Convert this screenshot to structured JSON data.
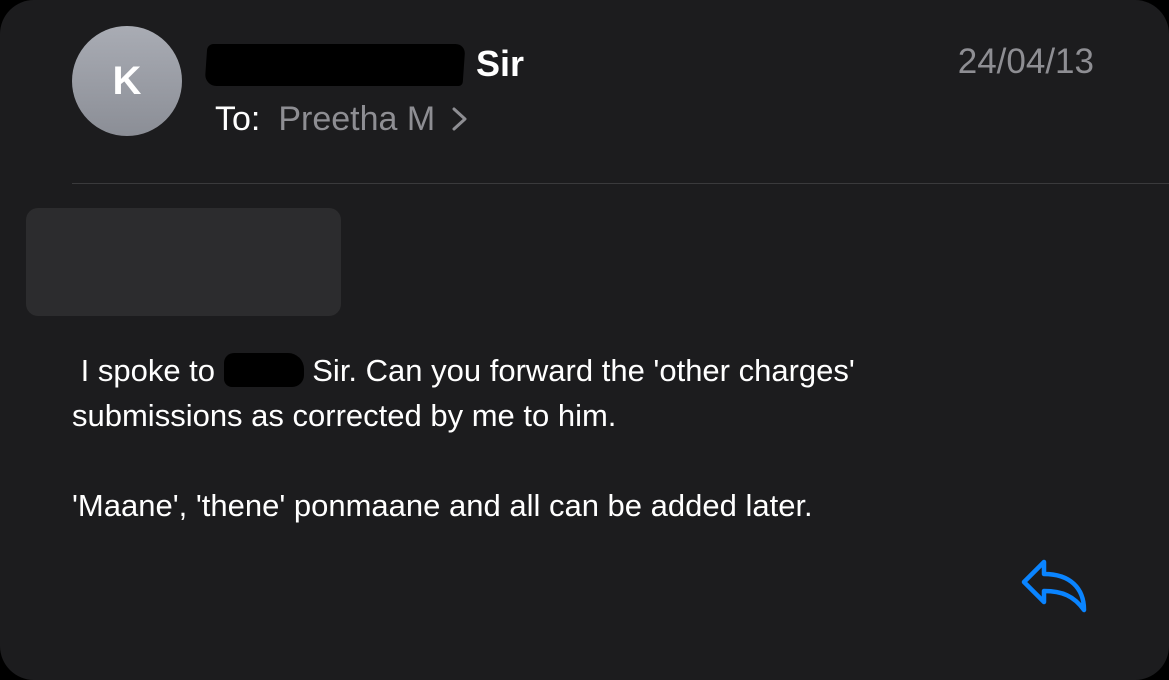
{
  "message": {
    "avatar_initial": "K",
    "sender_suffix": "Sir",
    "date": "24/04/13",
    "to_label": "To:",
    "recipient": "Preetha M",
    "body": {
      "line1_part1": " I spoke to ",
      "line1_part2": " Sir. Can you forward the 'other charges'",
      "line2": "submissions as corrected by me to him.",
      "paragraph2": "'Maane', 'thene' ponmaane and all can be added later."
    }
  },
  "colors": {
    "background": "#1c1c1e",
    "text_primary": "#ffffff",
    "text_secondary": "#8e8e93",
    "accent": "#0a84ff"
  },
  "icons": {
    "chevron": "chevron-right-icon",
    "reply": "reply-icon"
  }
}
